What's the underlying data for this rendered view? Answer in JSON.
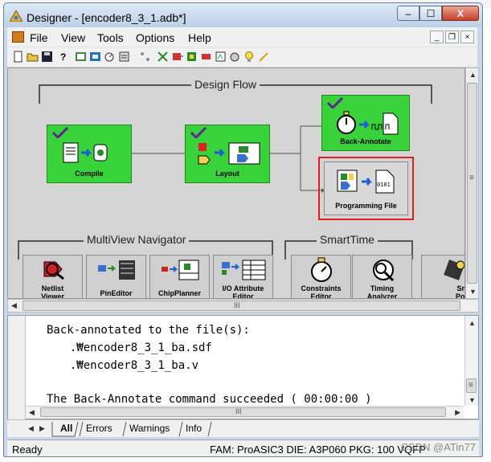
{
  "window": {
    "title": "Designer - [encoder8_3_1.adb*]",
    "buttons": {
      "minimize": "–",
      "maximize": "☐",
      "close": "X"
    }
  },
  "menubar": {
    "items": [
      "File",
      "View",
      "Tools",
      "Options",
      "Help"
    ],
    "mdi": {
      "minimize": "_",
      "restore": "❐",
      "close": "×"
    }
  },
  "toolbar": {
    "icons": [
      "new-icon",
      "open-icon",
      "save-icon",
      "help-icon",
      "netlist-icon",
      "layout-icon",
      "timing-icon",
      "report-icon",
      "hier-icon",
      "cross-probe-icon",
      "pin-icon",
      "chip-icon",
      "io-icon",
      "smarttime-icon",
      "power-icon",
      "bulb-icon",
      "wand-icon"
    ]
  },
  "design_flow": {
    "title": "Design Flow",
    "steps": [
      {
        "label": "Compile",
        "completed": true
      },
      {
        "label": "Layout",
        "completed": true
      },
      {
        "label": "Back-Annotate",
        "completed": true
      },
      {
        "label": "Programming File",
        "completed": false,
        "highlighted": true
      }
    ]
  },
  "multiview": {
    "title": "MultiView Navigator",
    "tools": [
      "Netlist Viewer",
      "PinEditor",
      "ChipPlanner",
      "I/O Attribute Editor"
    ]
  },
  "smarttime": {
    "title": "SmartTime",
    "tools": [
      "Constraints Editor",
      "Timing Analyzer"
    ]
  },
  "extra_tool": "Smart Power",
  "scroll": {
    "thumb_glyph": "III",
    "vthumb_glyph": "≡"
  },
  "log": {
    "lines": [
      "Back-annotated to the file(s):",
      "  .₩encoder8_3_1_ba.sdf",
      "  .₩encoder8_3_1_ba.v",
      "",
      "The Back-Annotate command succeeded ( 00:00:00 )"
    ]
  },
  "log_tabs": [
    "All",
    "Errors",
    "Warnings",
    "Info"
  ],
  "status": {
    "left": "Ready",
    "right": "FAM: ProASIC3  DIE: A3P060  PKG: 100 VQFP"
  },
  "watermark": "CSDN @ATin77",
  "colors": {
    "flow_green": "#3ad23a",
    "highlight_red": "#e02020",
    "panel_gray": "#d4d4d4"
  }
}
